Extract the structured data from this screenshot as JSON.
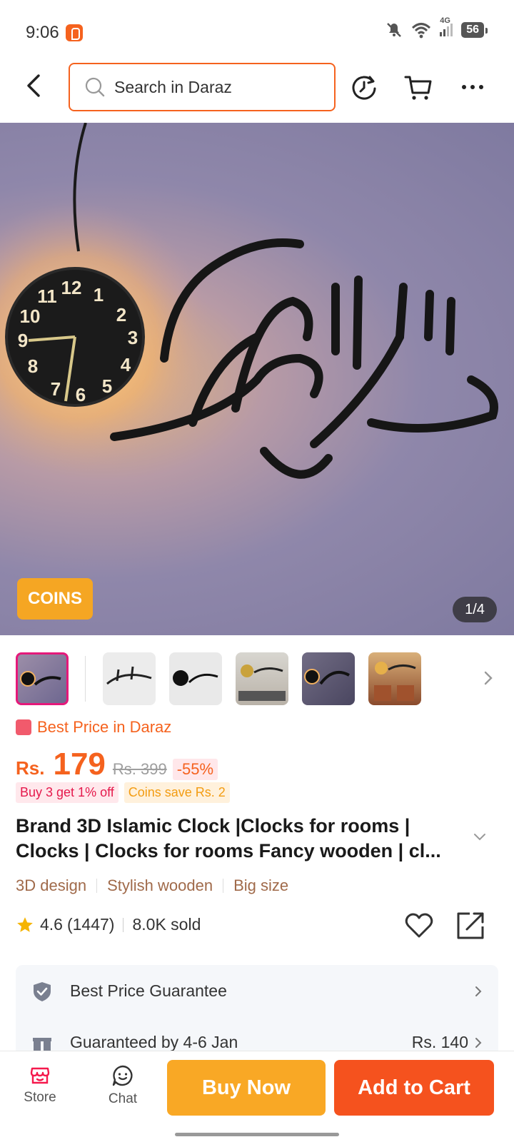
{
  "status_bar": {
    "time": "9:06",
    "network": "4G",
    "battery": "56",
    "icons": [
      "mute-icon",
      "wifi-icon",
      "signal-icon",
      "battery-icon"
    ]
  },
  "header": {
    "search_placeholder": "Search in Daraz",
    "icons": [
      "back-icon",
      "search-icon",
      "history-icon",
      "cart-icon",
      "more-icon"
    ]
  },
  "gallery": {
    "coins_badge": "COINS",
    "page_counter": "1/4",
    "thumbnail_count": 6
  },
  "price": {
    "best_price_label": "Best Price in Daraz",
    "currency": "Rs.",
    "current": "179",
    "original": "Rs. 399",
    "discount": "-55%",
    "promos": [
      "Buy 3 get 1% off",
      "Coins save Rs. 2"
    ]
  },
  "product": {
    "title_line1": "Brand 3D Islamic Clock |Clocks for rooms |",
    "title_line2": "Clocks | Clocks for rooms Fancy wooden | cl...",
    "tags": [
      "3D design",
      "Stylish wooden",
      "Big size"
    ],
    "rating": "4.6",
    "reviews": "(1447)",
    "sold": "8.0K sold"
  },
  "services": {
    "rows": [
      {
        "label": "Best Price Guarantee",
        "value": ""
      },
      {
        "label": "Guaranteed by 4-6 Jan",
        "value": "Rs. 140"
      }
    ]
  },
  "bottom_bar": {
    "store_label": "Store",
    "chat_label": "Chat",
    "buy_now": "Buy Now",
    "add_to_cart": "Add to Cart"
  },
  "colors": {
    "brand_orange": "#f5621e",
    "buy_now_yellow": "#f9a825",
    "coins_badge": "#f5a623",
    "tag_brown": "#a06a4a"
  }
}
